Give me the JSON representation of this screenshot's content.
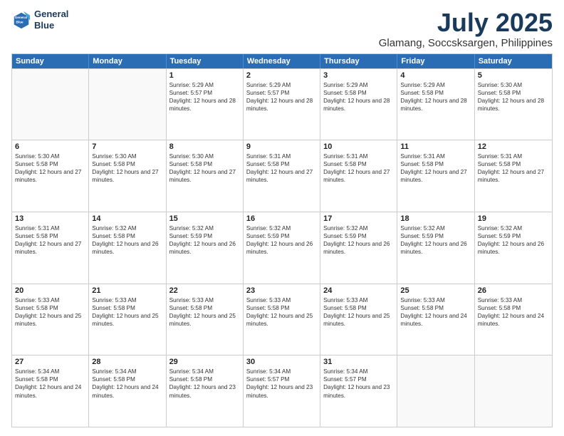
{
  "logo": {
    "line1": "General",
    "line2": "Blue"
  },
  "header": {
    "month": "July 2025",
    "location": "Glamang, Soccsksargen, Philippines"
  },
  "weekdays": [
    "Sunday",
    "Monday",
    "Tuesday",
    "Wednesday",
    "Thursday",
    "Friday",
    "Saturday"
  ],
  "weeks": [
    [
      {
        "day": "",
        "sunrise": "",
        "sunset": "",
        "daylight": ""
      },
      {
        "day": "",
        "sunrise": "",
        "sunset": "",
        "daylight": ""
      },
      {
        "day": "1",
        "sunrise": "Sunrise: 5:29 AM",
        "sunset": "Sunset: 5:57 PM",
        "daylight": "Daylight: 12 hours and 28 minutes."
      },
      {
        "day": "2",
        "sunrise": "Sunrise: 5:29 AM",
        "sunset": "Sunset: 5:57 PM",
        "daylight": "Daylight: 12 hours and 28 minutes."
      },
      {
        "day": "3",
        "sunrise": "Sunrise: 5:29 AM",
        "sunset": "Sunset: 5:58 PM",
        "daylight": "Daylight: 12 hours and 28 minutes."
      },
      {
        "day": "4",
        "sunrise": "Sunrise: 5:29 AM",
        "sunset": "Sunset: 5:58 PM",
        "daylight": "Daylight: 12 hours and 28 minutes."
      },
      {
        "day": "5",
        "sunrise": "Sunrise: 5:30 AM",
        "sunset": "Sunset: 5:58 PM",
        "daylight": "Daylight: 12 hours and 28 minutes."
      }
    ],
    [
      {
        "day": "6",
        "sunrise": "Sunrise: 5:30 AM",
        "sunset": "Sunset: 5:58 PM",
        "daylight": "Daylight: 12 hours and 27 minutes."
      },
      {
        "day": "7",
        "sunrise": "Sunrise: 5:30 AM",
        "sunset": "Sunset: 5:58 PM",
        "daylight": "Daylight: 12 hours and 27 minutes."
      },
      {
        "day": "8",
        "sunrise": "Sunrise: 5:30 AM",
        "sunset": "Sunset: 5:58 PM",
        "daylight": "Daylight: 12 hours and 27 minutes."
      },
      {
        "day": "9",
        "sunrise": "Sunrise: 5:31 AM",
        "sunset": "Sunset: 5:58 PM",
        "daylight": "Daylight: 12 hours and 27 minutes."
      },
      {
        "day": "10",
        "sunrise": "Sunrise: 5:31 AM",
        "sunset": "Sunset: 5:58 PM",
        "daylight": "Daylight: 12 hours and 27 minutes."
      },
      {
        "day": "11",
        "sunrise": "Sunrise: 5:31 AM",
        "sunset": "Sunset: 5:58 PM",
        "daylight": "Daylight: 12 hours and 27 minutes."
      },
      {
        "day": "12",
        "sunrise": "Sunrise: 5:31 AM",
        "sunset": "Sunset: 5:58 PM",
        "daylight": "Daylight: 12 hours and 27 minutes."
      }
    ],
    [
      {
        "day": "13",
        "sunrise": "Sunrise: 5:31 AM",
        "sunset": "Sunset: 5:58 PM",
        "daylight": "Daylight: 12 hours and 27 minutes."
      },
      {
        "day": "14",
        "sunrise": "Sunrise: 5:32 AM",
        "sunset": "Sunset: 5:58 PM",
        "daylight": "Daylight: 12 hours and 26 minutes."
      },
      {
        "day": "15",
        "sunrise": "Sunrise: 5:32 AM",
        "sunset": "Sunset: 5:59 PM",
        "daylight": "Daylight: 12 hours and 26 minutes."
      },
      {
        "day": "16",
        "sunrise": "Sunrise: 5:32 AM",
        "sunset": "Sunset: 5:59 PM",
        "daylight": "Daylight: 12 hours and 26 minutes."
      },
      {
        "day": "17",
        "sunrise": "Sunrise: 5:32 AM",
        "sunset": "Sunset: 5:59 PM",
        "daylight": "Daylight: 12 hours and 26 minutes."
      },
      {
        "day": "18",
        "sunrise": "Sunrise: 5:32 AM",
        "sunset": "Sunset: 5:59 PM",
        "daylight": "Daylight: 12 hours and 26 minutes."
      },
      {
        "day": "19",
        "sunrise": "Sunrise: 5:32 AM",
        "sunset": "Sunset: 5:59 PM",
        "daylight": "Daylight: 12 hours and 26 minutes."
      }
    ],
    [
      {
        "day": "20",
        "sunrise": "Sunrise: 5:33 AM",
        "sunset": "Sunset: 5:58 PM",
        "daylight": "Daylight: 12 hours and 25 minutes."
      },
      {
        "day": "21",
        "sunrise": "Sunrise: 5:33 AM",
        "sunset": "Sunset: 5:58 PM",
        "daylight": "Daylight: 12 hours and 25 minutes."
      },
      {
        "day": "22",
        "sunrise": "Sunrise: 5:33 AM",
        "sunset": "Sunset: 5:58 PM",
        "daylight": "Daylight: 12 hours and 25 minutes."
      },
      {
        "day": "23",
        "sunrise": "Sunrise: 5:33 AM",
        "sunset": "Sunset: 5:58 PM",
        "daylight": "Daylight: 12 hours and 25 minutes."
      },
      {
        "day": "24",
        "sunrise": "Sunrise: 5:33 AM",
        "sunset": "Sunset: 5:58 PM",
        "daylight": "Daylight: 12 hours and 25 minutes."
      },
      {
        "day": "25",
        "sunrise": "Sunrise: 5:33 AM",
        "sunset": "Sunset: 5:58 PM",
        "daylight": "Daylight: 12 hours and 24 minutes."
      },
      {
        "day": "26",
        "sunrise": "Sunrise: 5:33 AM",
        "sunset": "Sunset: 5:58 PM",
        "daylight": "Daylight: 12 hours and 24 minutes."
      }
    ],
    [
      {
        "day": "27",
        "sunrise": "Sunrise: 5:34 AM",
        "sunset": "Sunset: 5:58 PM",
        "daylight": "Daylight: 12 hours and 24 minutes."
      },
      {
        "day": "28",
        "sunrise": "Sunrise: 5:34 AM",
        "sunset": "Sunset: 5:58 PM",
        "daylight": "Daylight: 12 hours and 24 minutes."
      },
      {
        "day": "29",
        "sunrise": "Sunrise: 5:34 AM",
        "sunset": "Sunset: 5:58 PM",
        "daylight": "Daylight: 12 hours and 23 minutes."
      },
      {
        "day": "30",
        "sunrise": "Sunrise: 5:34 AM",
        "sunset": "Sunset: 5:57 PM",
        "daylight": "Daylight: 12 hours and 23 minutes."
      },
      {
        "day": "31",
        "sunrise": "Sunrise: 5:34 AM",
        "sunset": "Sunset: 5:57 PM",
        "daylight": "Daylight: 12 hours and 23 minutes."
      },
      {
        "day": "",
        "sunrise": "",
        "sunset": "",
        "daylight": ""
      },
      {
        "day": "",
        "sunrise": "",
        "sunset": "",
        "daylight": ""
      }
    ]
  ]
}
